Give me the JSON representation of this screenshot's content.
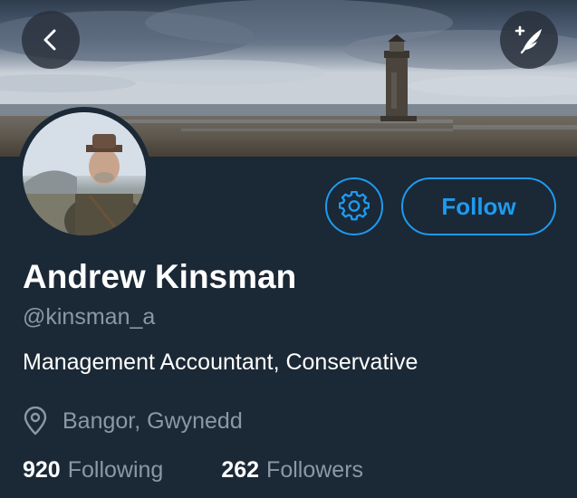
{
  "header": {
    "back_icon": "chevron-left-icon",
    "compose_icon": "compose-feather-icon"
  },
  "profile": {
    "name": "Andrew Kinsman",
    "handle": "@kinsman_a",
    "bio": "Management Accountant, Conservative",
    "location": "Bangor, Gwynedd",
    "avatar_alt": "Profile photo"
  },
  "actions": {
    "settings_icon": "gear-icon",
    "follow_label": "Follow"
  },
  "stats": {
    "following_count": "920",
    "following_label": "Following",
    "followers_count": "262",
    "followers_label": "Followers"
  },
  "colors": {
    "background": "#1b2836",
    "accent": "#1d9bf0",
    "secondary_text": "#8b98a5"
  }
}
